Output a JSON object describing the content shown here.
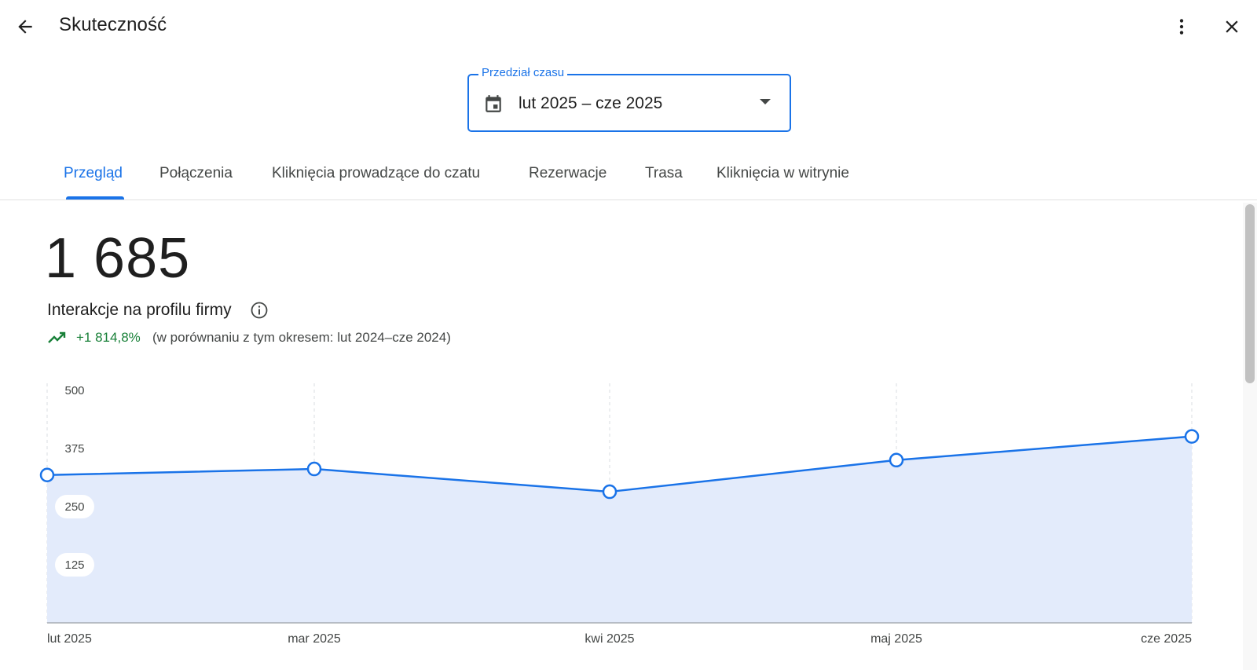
{
  "header": {
    "title": "Skuteczność",
    "back_icon": "arrow-back-icon",
    "more_icon": "more-vert-icon",
    "close_icon": "close-icon"
  },
  "date_range": {
    "label": "Przedział czasu",
    "value": "lut 2025 – cze 2025",
    "icon": "calendar-icon"
  },
  "tabs": [
    {
      "label": "Przegląd",
      "active": true
    },
    {
      "label": "Połączenia",
      "active": false
    },
    {
      "label": "Kliknięcia prowadzące do czatu",
      "active": false
    },
    {
      "label": "Rezerwacje",
      "active": false
    },
    {
      "label": "Trasa",
      "active": false
    },
    {
      "label": "Kliknięcia w witrynie",
      "active": false
    }
  ],
  "summary": {
    "total": "1 685",
    "label": "Interakcje na profilu firmy",
    "change": "+1 814,8%",
    "comparison": "(w porównaniu z tym okresem: lut 2024–cze 2024)",
    "trend_icon": "trending-up-icon",
    "info_icon": "info-icon"
  },
  "colors": {
    "accent": "#1a73e8",
    "positive": "#188038",
    "area_fill": "#e3ebfb"
  },
  "chart_data": {
    "type": "area",
    "x": [
      "lut 2025",
      "mar 2025",
      "kwi 2025",
      "maj 2025",
      "cze 2025"
    ],
    "values": [
      318,
      331,
      282,
      350,
      401
    ],
    "ylim": [
      0,
      500
    ],
    "yticks": [
      "500",
      "375",
      "250",
      "125"
    ],
    "grid": "vertical dashed",
    "title": "",
    "xlabel": "",
    "ylabel": ""
  }
}
